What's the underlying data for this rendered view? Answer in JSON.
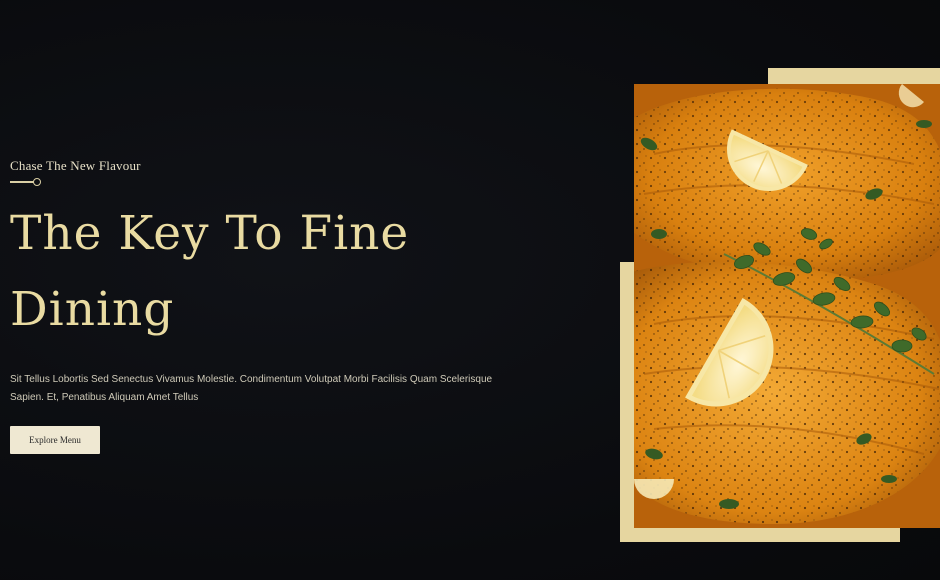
{
  "hero": {
    "tagline": "Chase The New Flavour",
    "headline": "The Key To Fine Dining",
    "description": "Sit Tellus Lobortis Sed Senectus Vivamus Molestie. Condimentum Volutpat Morbi Facilisis Quam Scelerisque Sapien. Et, Penatibus Aliquam Amet Tellus",
    "cta_label": "Explore Menu"
  },
  "image": {
    "subject": "crusted fish fillets with lemon wedges and herbs"
  },
  "colors": {
    "background": "#0b0d10",
    "headline": "#e9dba2",
    "accent_frame": "#e6d6a0",
    "button_bg": "#efe8d2"
  }
}
